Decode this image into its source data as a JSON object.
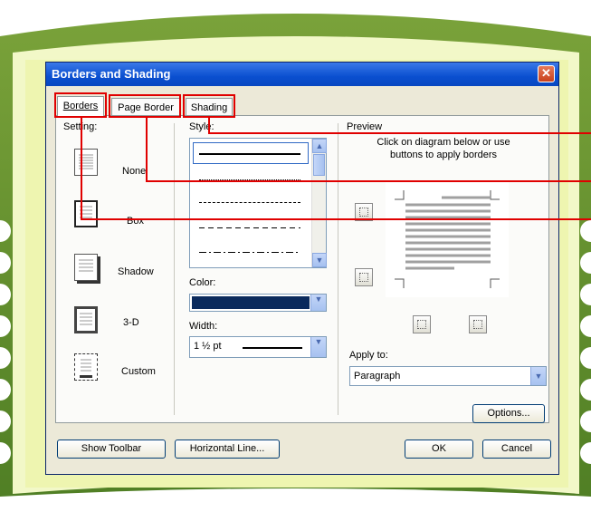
{
  "dialog": {
    "title": "Borders and Shading",
    "tabs": [
      "Borders",
      "Page Border",
      "Shading"
    ]
  },
  "setting": {
    "label": "Setting:",
    "items": [
      "None",
      "Box",
      "Shadow",
      "3-D",
      "Custom"
    ]
  },
  "style": {
    "label": "Style:"
  },
  "color": {
    "label": "Color:",
    "value_hex": "#0a2a5c"
  },
  "width": {
    "label": "Width:",
    "value": "1 ½ pt"
  },
  "preview": {
    "label": "Preview",
    "instructions": "Click on diagram below or use buttons to apply borders"
  },
  "apply_to": {
    "label": "Apply to:",
    "value": "Paragraph"
  },
  "buttons": {
    "options": "Options...",
    "show_toolbar": "Show Toolbar",
    "horizontal_line": "Horizontal Line...",
    "ok": "OK",
    "cancel": "Cancel"
  },
  "colors": {
    "annotation": "#e00000",
    "title_bar": "#0a4fd0",
    "frame": "#e6f0a0"
  }
}
